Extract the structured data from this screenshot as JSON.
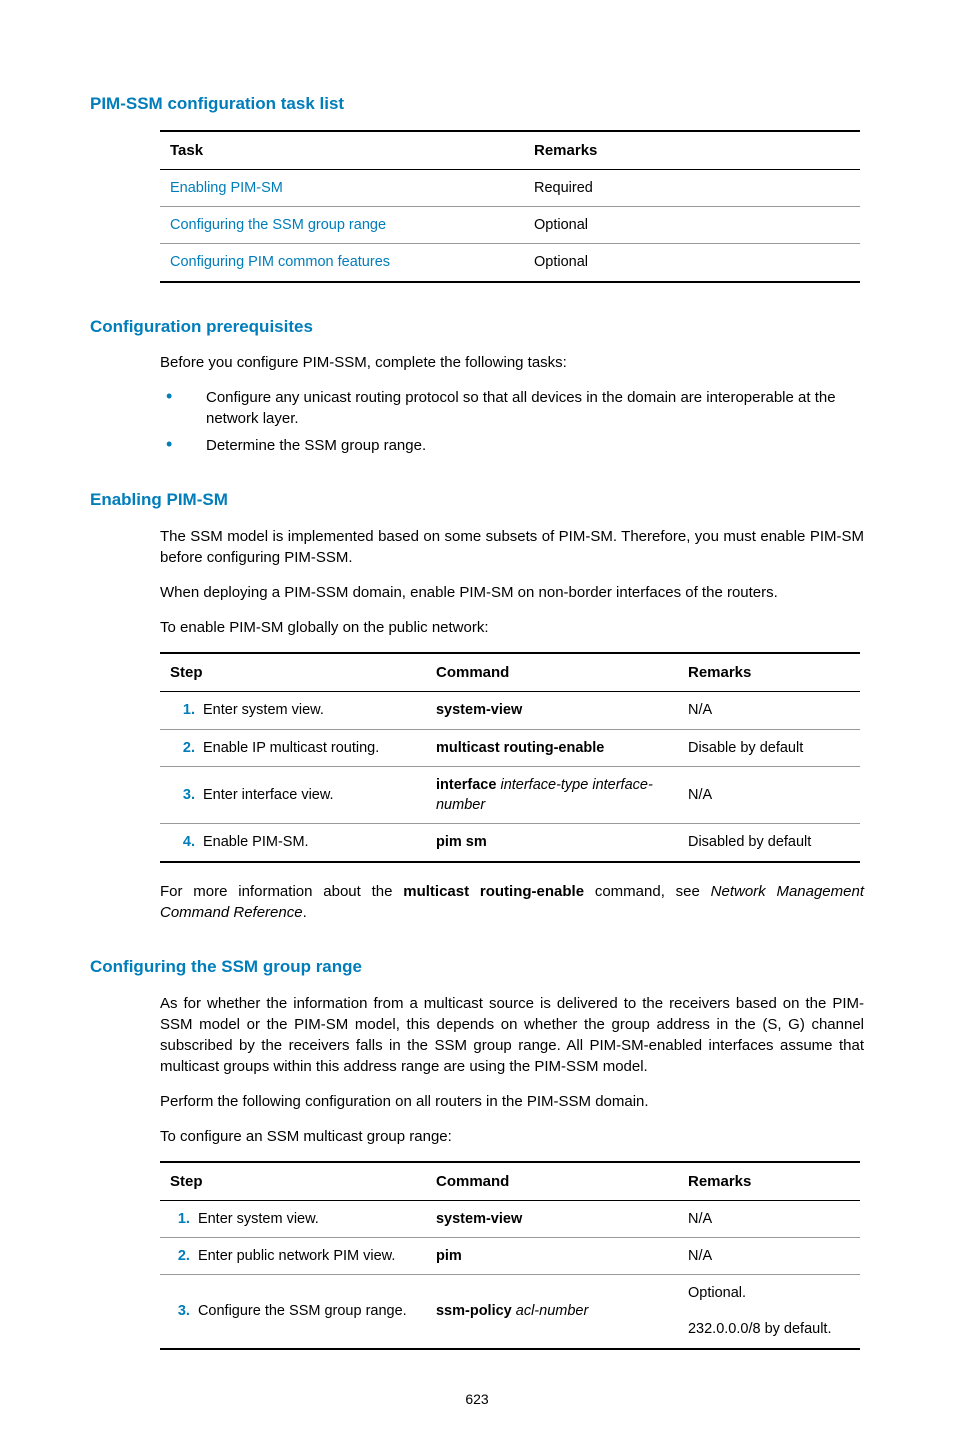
{
  "headings": {
    "tasklist": "PIM-SSM configuration task list",
    "prereq": "Configuration prerequisites",
    "enablesm": "Enabling PIM-SM",
    "ssmrange": "Configuring the SSM group range"
  },
  "table1": {
    "h_task": "Task",
    "h_remarks": "Remarks",
    "rows": [
      {
        "task": "Enabling PIM-SM",
        "remarks": "Required"
      },
      {
        "task": "Configuring the SSM group range",
        "remarks": "Optional"
      },
      {
        "task": "Configuring PIM common features",
        "remarks": "Optional"
      }
    ]
  },
  "prereq": {
    "intro": "Before you configure PIM-SSM, complete the following tasks:",
    "b1": "Configure any unicast routing protocol so that all devices in the domain are interoperable at the network layer.",
    "b2": "Determine the SSM group range."
  },
  "enablesm": {
    "p1": "The SSM model is implemented based on some subsets of PIM-SM. Therefore, you must enable PIM-SM before configuring PIM-SSM.",
    "p2": "When deploying a PIM-SSM domain, enable PIM-SM on non-border interfaces of the routers.",
    "p3": "To enable PIM-SM globally on the public network:",
    "note_pre": "For more information about the ",
    "note_bold": "multicast routing-enable",
    "note_mid": " command, see ",
    "note_italic": "Network Management Command Reference",
    "note_end": "."
  },
  "table2": {
    "h_step": "Step",
    "h_cmd": "Command",
    "h_remarks": "Remarks",
    "rows": [
      {
        "n": "1.",
        "step": "Enter system view.",
        "cmd_b": "system-view",
        "cmd_i": "",
        "remarks": "N/A"
      },
      {
        "n": "2.",
        "step": "Enable IP multicast routing.",
        "cmd_b": "multicast routing-enable",
        "cmd_i": "",
        "remarks": "Disable by default"
      },
      {
        "n": "3.",
        "step": "Enter interface view.",
        "cmd_b": "interface",
        "cmd_i": " interface-type interface-number",
        "remarks": "N/A"
      },
      {
        "n": "4.",
        "step": "Enable PIM-SM.",
        "cmd_b": "pim sm",
        "cmd_i": "",
        "remarks": "Disabled by default"
      }
    ]
  },
  "ssmrange": {
    "p1": "As for whether the information from a multicast source is delivered to the receivers based on the PIM-SSM model or the PIM-SM model, this depends on whether the group address in the (S, G) channel subscribed by the receivers falls in the SSM group range. All PIM-SM-enabled interfaces assume that multicast groups within this address range are using the PIM-SSM model.",
    "p2": "Perform the following configuration on all routers in the PIM-SSM domain.",
    "p3": "To configure an SSM multicast group range:"
  },
  "table3": {
    "h_step": "Step",
    "h_cmd": "Command",
    "h_remarks": "Remarks",
    "rows": [
      {
        "n": "1.",
        "step": "Enter system view.",
        "cmd_b": "system-view",
        "cmd_i": "",
        "remarks": "N/A"
      },
      {
        "n": "2.",
        "step": "Enter public network PIM view.",
        "cmd_b": "pim",
        "cmd_i": "",
        "remarks": "N/A"
      },
      {
        "n": "3.",
        "step": "Configure the SSM group range.",
        "cmd_b": "ssm-policy",
        "cmd_i": " acl-number",
        "remarks_l1": "Optional.",
        "remarks_l2": "232.0.0.0/8 by default."
      }
    ]
  },
  "page": "623"
}
